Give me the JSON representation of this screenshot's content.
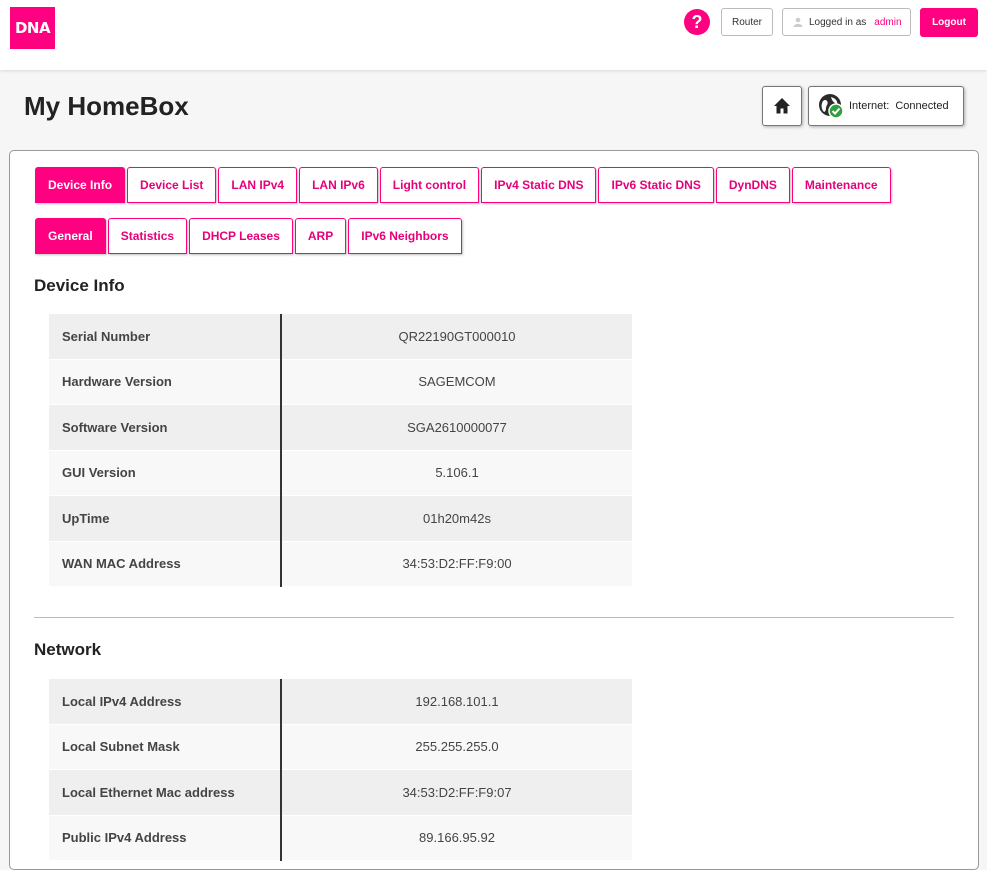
{
  "header": {
    "logo_text": "DNA",
    "help_label": "?",
    "router_label": "Router",
    "logged_in_label": "Logged in as",
    "user": "admin",
    "logout_label": "Logout"
  },
  "title": "My HomeBox",
  "status": {
    "label": "Internet:",
    "value": "Connected"
  },
  "tabs": [
    {
      "label": "Device Info",
      "active": true
    },
    {
      "label": "Device List"
    },
    {
      "label": "LAN IPv4"
    },
    {
      "label": "LAN IPv6"
    },
    {
      "label": "Light control"
    },
    {
      "label": "IPv4 Static DNS"
    },
    {
      "label": "IPv6 Static DNS"
    },
    {
      "label": "DynDNS"
    },
    {
      "label": "Maintenance"
    }
  ],
  "subtabs": [
    {
      "label": "General",
      "active": true
    },
    {
      "label": "Statistics"
    },
    {
      "label": "DHCP Leases"
    },
    {
      "label": "ARP"
    },
    {
      "label": "IPv6 Neighbors"
    }
  ],
  "device_info": {
    "title": "Device Info",
    "rows": [
      {
        "key": "Serial Number",
        "value": "QR22190GT000010"
      },
      {
        "key": "Hardware Version",
        "value": "SAGEMCOM"
      },
      {
        "key": "Software Version",
        "value": "SGA2610000077"
      },
      {
        "key": "GUI Version",
        "value": "5.106.1"
      },
      {
        "key": "UpTime",
        "value": "01h20m42s"
      },
      {
        "key": "WAN MAC Address",
        "value": "34:53:D2:FF:F9:00"
      }
    ]
  },
  "network": {
    "title": "Network",
    "rows": [
      {
        "key": "Local IPv4 Address",
        "value": "192.168.101.1"
      },
      {
        "key": "Local Subnet Mask",
        "value": "255.255.255.0"
      },
      {
        "key": "Local Ethernet Mac address",
        "value": "34:53:D2:FF:F9:07"
      },
      {
        "key": "Public IPv4 Address",
        "value": "89.166.95.92"
      }
    ]
  },
  "colors": {
    "accent": "#ff0080",
    "status_ok": "#2e9e3e"
  },
  "icons": {
    "home": "home-icon",
    "globe": "globe-check-icon",
    "user": "user-icon"
  }
}
